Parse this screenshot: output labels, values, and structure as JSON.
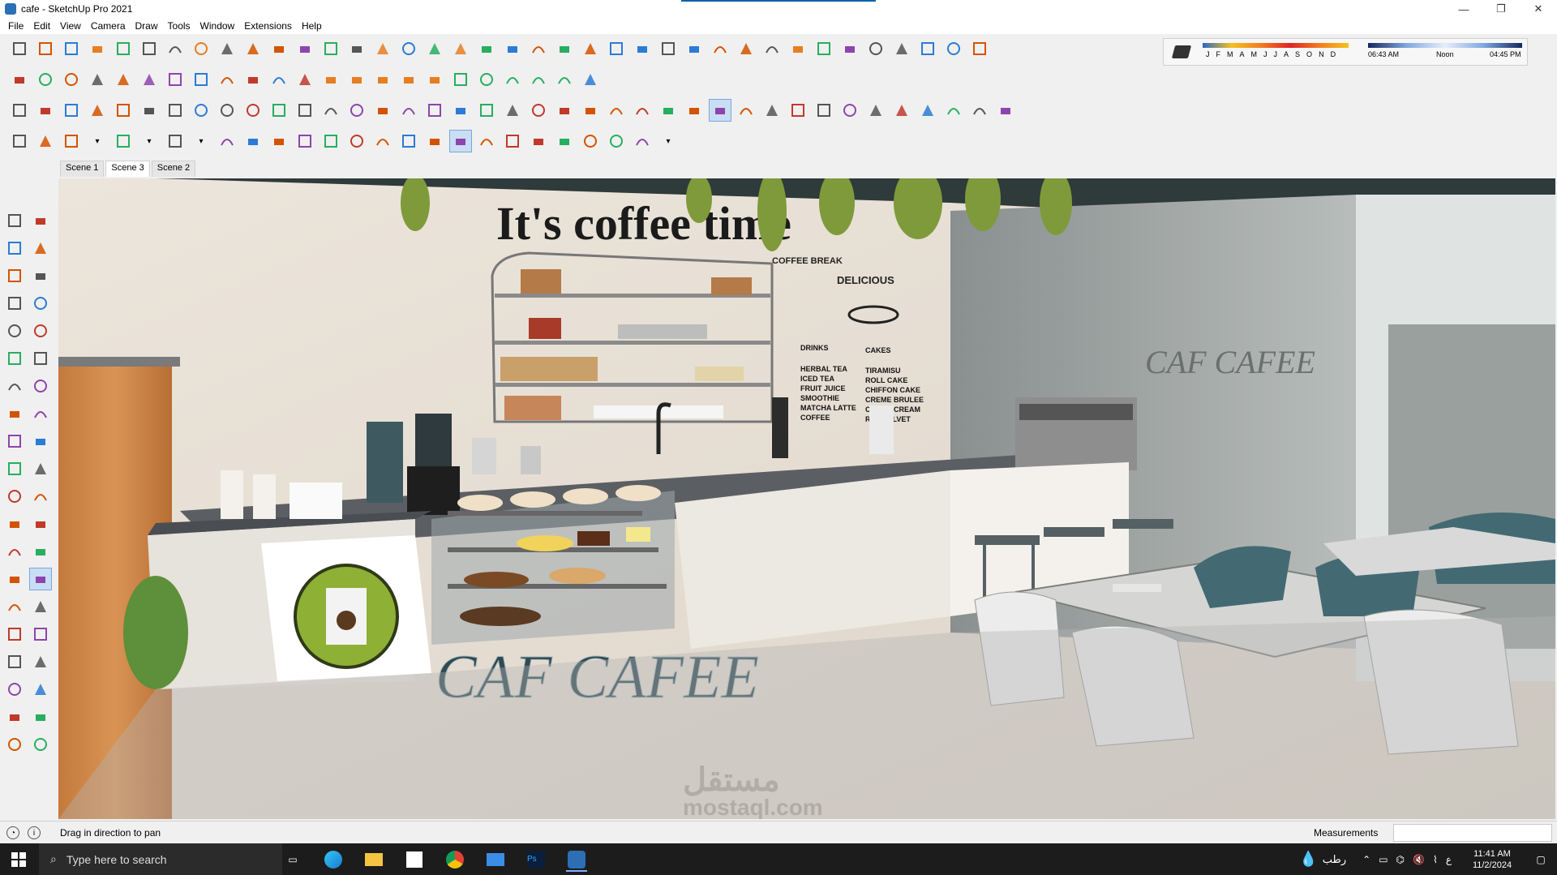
{
  "window": {
    "title": "cafe - SketchUp Pro 2021",
    "controls": {
      "minimize": "—",
      "maximize": "❐",
      "close": "✕"
    }
  },
  "menu": [
    "File",
    "Edit",
    "View",
    "Camera",
    "Draw",
    "Tools",
    "Window",
    "Extensions",
    "Help"
  ],
  "shadows": {
    "months": [
      "J",
      "F",
      "M",
      "A",
      "M",
      "J",
      "J",
      "A",
      "S",
      "O",
      "N",
      "D"
    ],
    "time_start": "06:43 AM",
    "time_mid": "Noon",
    "time_end": "04:45 PM"
  },
  "scenes": [
    {
      "label": "Scene 1",
      "active": false
    },
    {
      "label": "Scene 3",
      "active": true
    },
    {
      "label": "Scene 2",
      "active": false
    }
  ],
  "toolbar": {
    "row1_icons": [
      "select-icon",
      "pencil-icon",
      "paint-icon",
      "scissors-icon",
      "gear-icon",
      "cloud-icon",
      "pie-icon",
      "spiral-icon",
      "sphere-icon",
      "tube-icon",
      "corner-icon",
      "line-icon",
      "arc-icon",
      "curve-icon",
      "book-icon",
      "cone-icon",
      "grid-icon",
      "lattice-icon",
      "mesh-icon",
      "fan-icon",
      "frame-icon",
      "stack-icon",
      "ramp-icon",
      "zig-icon",
      "cross-icon",
      "link-icon",
      "arch-icon",
      "slab-icon",
      "ring-icon",
      "panel-icon",
      "box-icon",
      "slot-icon",
      "bars-icon",
      "globe-icon",
      "wing-icon",
      "wave-icon",
      "fold-icon",
      "home-icon"
    ],
    "row2_icons": [
      "warehouse-icon",
      "refresh-icon",
      "layers-icon",
      "add-icon",
      "tree-icon",
      "stairs-icon",
      "checker-icon",
      "upload-icon",
      "cog-icon",
      "mail-icon",
      "info-icon",
      "user-icon",
      "box-icon",
      "box-icon",
      "box-icon",
      "box-icon",
      "box-icon",
      "cube-icon",
      "door-icon",
      "house-icon",
      "house-icon",
      "house-icon",
      "shop-icon"
    ],
    "row3_icons": [
      "select-icon",
      "component-icon",
      "paint-icon",
      "eraser-icon",
      "pencil-icon",
      "freehand-icon",
      "rect-icon",
      "rotrect-icon",
      "circle-icon",
      "polygon-icon",
      "arc-icon",
      "arc2-icon",
      "pie-icon",
      "arc3-icon",
      "move-icon",
      "pushpull-icon",
      "rotate-icon",
      "followme-icon",
      "scale-icon",
      "offset-icon",
      "tape-icon",
      "dim-icon",
      "protractor-icon",
      "text-icon",
      "axes-icon",
      "3dtext-icon",
      "orbit-icon",
      "pan-icon",
      "zoom-icon",
      "zoomwin-icon",
      "zoomext-icon",
      "position-icon",
      "walk-icon",
      "look-icon",
      "footprints-icon",
      "section-icon",
      "display-icon",
      "display2-icon",
      "display3-icon"
    ],
    "row4_icons": [
      "select-icon",
      "eraser-icon",
      "pencil-icon",
      "dropdown-icon",
      "arc-icon",
      "dropdown-icon",
      "rect-icon",
      "dropdown-icon",
      "pushpull-icon",
      "followme-icon",
      "move-icon",
      "rotate-icon",
      "scale-icon",
      "tape-icon",
      "text-icon",
      "paint-icon",
      "orbit-icon",
      "pan-icon",
      "zoom-icon",
      "zoomext-icon",
      "warehouse-icon",
      "extension-icon",
      "layers-icon",
      "sandbox-icon",
      "profile-icon",
      "dropdown-icon"
    ]
  },
  "left_tools": [
    "select-icon",
    "component-icon",
    "paint-icon",
    "eraser-icon",
    "pencil-icon",
    "freehand-icon",
    "rect-icon",
    "rotrect-icon",
    "circle-icon",
    "polygon-icon",
    "arc-icon",
    "arc2-icon",
    "pie-icon",
    "arc3-icon",
    "move-icon",
    "pushpull-icon",
    "rotate-icon",
    "followme-icon",
    "scale-icon",
    "offset-icon",
    "tape-icon",
    "text-icon",
    "protractor-icon",
    "dim-icon",
    "axes-icon",
    "3dtext-icon",
    "orbit-icon",
    "pan-icon",
    "zoom-icon",
    "zoomwin-icon",
    "zoomext-icon",
    "prev-icon",
    "position-icon",
    "look-icon",
    "walk-icon",
    "section-icon",
    "warehouse-icon",
    "extension-icon",
    "layers-icon",
    "sandbox-icon"
  ],
  "scene": {
    "wall_heading": "It's coffee time",
    "coffee_break": "COFFEE BREAK",
    "delicious": "DELICIOUS",
    "menu_drinks_header": "DRINKS",
    "menu_cakes_header": "CAKES",
    "menu_drinks": [
      "HERBAL TEA",
      "ICED TEA",
      "FRUIT JUICE",
      "SMOOTHIE",
      "MATCHA LATTE",
      "COFFEE"
    ],
    "menu_cakes": [
      "TIRAMISU",
      "ROLL CAKE",
      "CHIFFON CAKE",
      "CREME BRULEE",
      "CHOUX CREAM",
      "RED VELVET"
    ],
    "counter_sign": "CAF CAFEE",
    "glass_sign": "CAF CAFEE",
    "watermark_ar": "مستقل",
    "watermark_en": "mostaql.com"
  },
  "status": {
    "hint": "Drag in direction to pan",
    "measurements_label": "Measurements",
    "measurements_value": ""
  },
  "taskbar": {
    "search_placeholder": "Type here to search",
    "apps": [
      "task-view-icon",
      "edge-icon",
      "explorer-icon",
      "store-icon",
      "chrome-icon",
      "mail-icon",
      "photoshop-icon",
      "sketchup-icon"
    ],
    "weather": "رطب",
    "time": "11:41 AM",
    "date": "11/2/2024",
    "lang": "ع"
  }
}
